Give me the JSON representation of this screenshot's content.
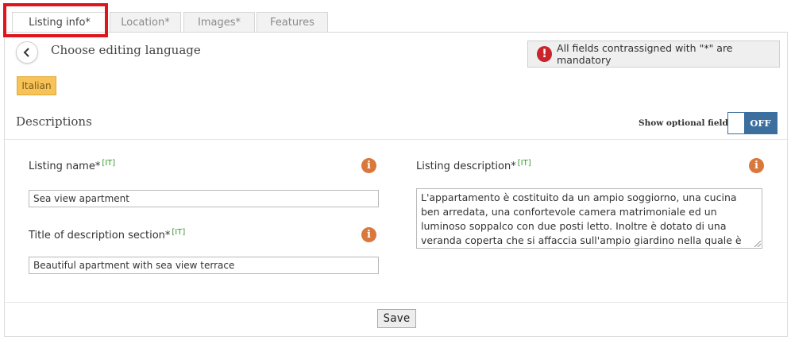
{
  "tabs": [
    {
      "label": "Listing info*",
      "active": true
    },
    {
      "label": "Location*",
      "active": false
    },
    {
      "label": "Images*",
      "active": false
    },
    {
      "label": "Features",
      "active": false
    }
  ],
  "header": {
    "title": "Choose editing language",
    "mandatory_notice": "All fields contrassigned with \"*\" are mandatory"
  },
  "language": {
    "selected": "Italian"
  },
  "descriptions": {
    "title": "Descriptions",
    "show_optional_label": "Show optional fields",
    "toggle_state": "OFF"
  },
  "fields": {
    "listing_name": {
      "label": "Listing name*",
      "lang_tag": "[IT]",
      "value": "Sea view apartment"
    },
    "section_title": {
      "label": "Title of description section*",
      "lang_tag": "[IT]",
      "value": "Beautiful apartment with sea view terrace"
    },
    "listing_description": {
      "label": "Listing description*",
      "lang_tag": "[IT]",
      "value": "L'appartamento è costituito da un ampio soggiorno, una cucina ben arredata, una confortevole camera matrimoniale ed un luminoso soppalco con due posti letto. Inoltre è dotato di una veranda coperta che si affaccia sull'ampio giardino nella quale è possibile mangiare all'aperto."
    }
  },
  "actions": {
    "save_label": "Save"
  },
  "colors": {
    "accent_blue": "#3d6f9e",
    "badge_yellow": "#f7c359",
    "info_orange": "#d8783c",
    "error_red": "#c9252b",
    "highlight_red": "#e0141b",
    "lang_tag_green": "#3a9a2f"
  },
  "icons": {
    "back": "chevron-left-icon",
    "mandatory": "exclamation-icon",
    "info": "info-icon"
  }
}
